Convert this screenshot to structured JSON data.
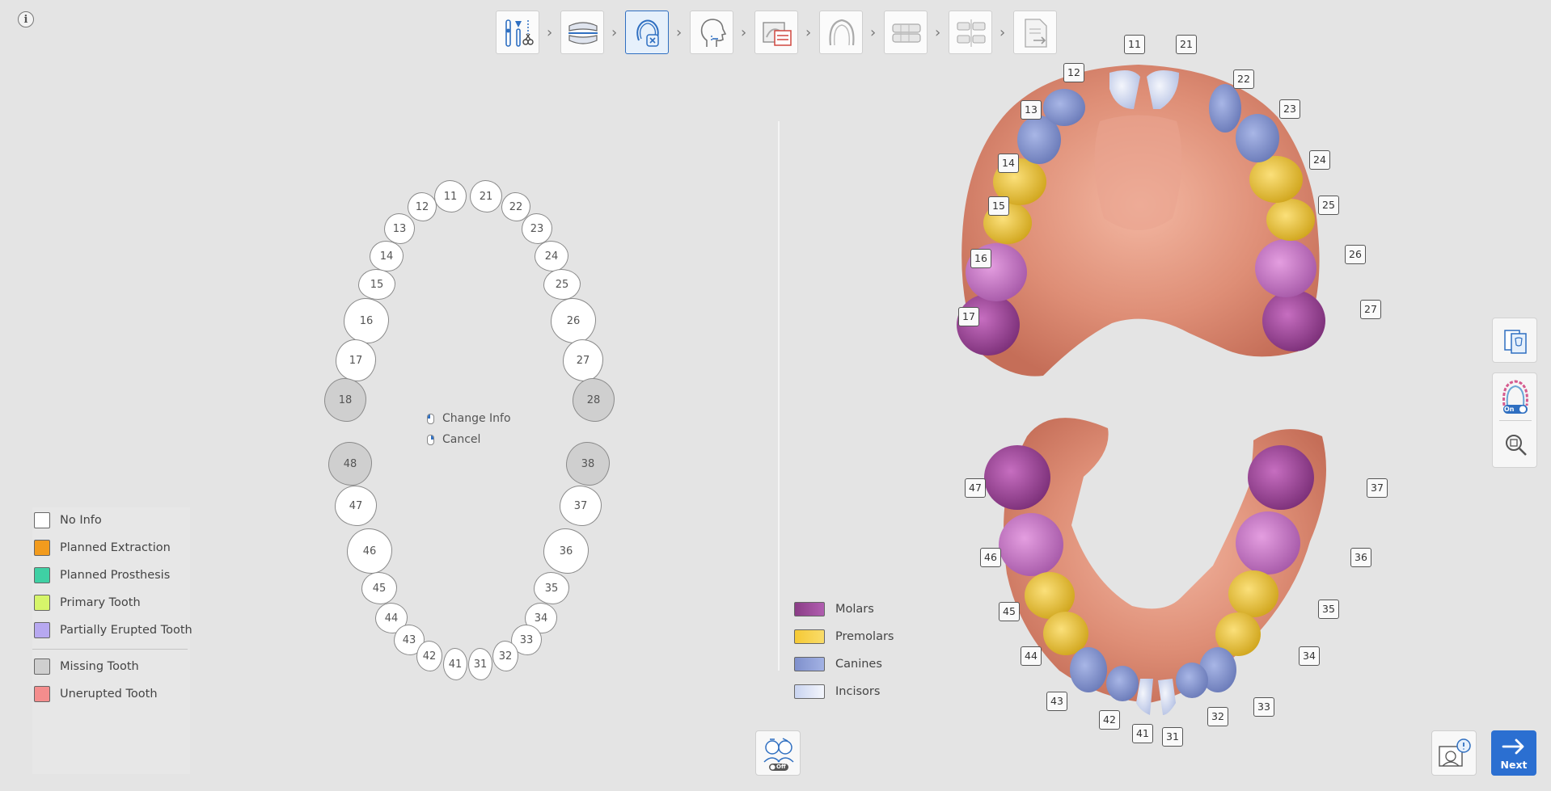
{
  "info_icon": "i",
  "workflow_steps": [
    {
      "name": "segmentation-tools-icon",
      "active": false
    },
    {
      "name": "occlusion-icon",
      "active": false
    },
    {
      "name": "tooth-setting-icon",
      "active": true
    },
    {
      "name": "face-profile-icon",
      "active": false
    },
    {
      "name": "xray-image-icon",
      "active": false
    },
    {
      "name": "arch-icon",
      "active": false
    },
    {
      "name": "setup-icon",
      "active": false
    },
    {
      "name": "comparison-icon",
      "active": false
    },
    {
      "name": "export-report-icon",
      "active": false
    }
  ],
  "tooth_chart": {
    "upper": [
      "11",
      "21",
      "12",
      "22",
      "13",
      "23",
      "14",
      "24",
      "15",
      "25",
      "16",
      "26",
      "17",
      "27",
      "18",
      "28"
    ],
    "lower": [
      "48",
      "38",
      "47",
      "37",
      "46",
      "36",
      "45",
      "35",
      "44",
      "34",
      "43",
      "33",
      "42",
      "32",
      "41",
      "31"
    ],
    "missing": [
      "18",
      "28",
      "48",
      "38"
    ]
  },
  "context_menu": {
    "change_info": "Change Info",
    "cancel": "Cancel"
  },
  "status_legend": [
    {
      "label": "No Info",
      "color": "#ffffff"
    },
    {
      "label": "Planned Extraction",
      "color": "#f29b1d"
    },
    {
      "label": "Planned Prosthesis",
      "color": "#3fd0a4"
    },
    {
      "label": "Primary Tooth",
      "color": "#d6f56a"
    },
    {
      "label": "Partially Erupted Tooth",
      "color": "#b7a8f0"
    },
    {
      "label": "Missing Tooth",
      "color": "#cfcfcf"
    },
    {
      "label": "Unerupted Tooth",
      "color": "#f48d8d"
    }
  ],
  "type_legend": [
    {
      "label": "Molars",
      "color": "#a14a9c"
    },
    {
      "label": "Premolars",
      "color": "#f2c53a"
    },
    {
      "label": "Canines",
      "color": "#8e9fd9"
    },
    {
      "label": "Incisors",
      "color": "#dfe6f6"
    }
  ],
  "model_labels": {
    "upper": [
      "11",
      "21",
      "12",
      "22",
      "13",
      "23",
      "14",
      "24",
      "15",
      "25",
      "16",
      "26",
      "17",
      "27"
    ],
    "lower": [
      "47",
      "37",
      "46",
      "36",
      "45",
      "35",
      "44",
      "34",
      "43",
      "33",
      "42",
      "32",
      "41",
      "31"
    ]
  },
  "right_tools": {
    "toggle_state": "On"
  },
  "bottom_toggle_state": "Off",
  "next_label": "Next"
}
